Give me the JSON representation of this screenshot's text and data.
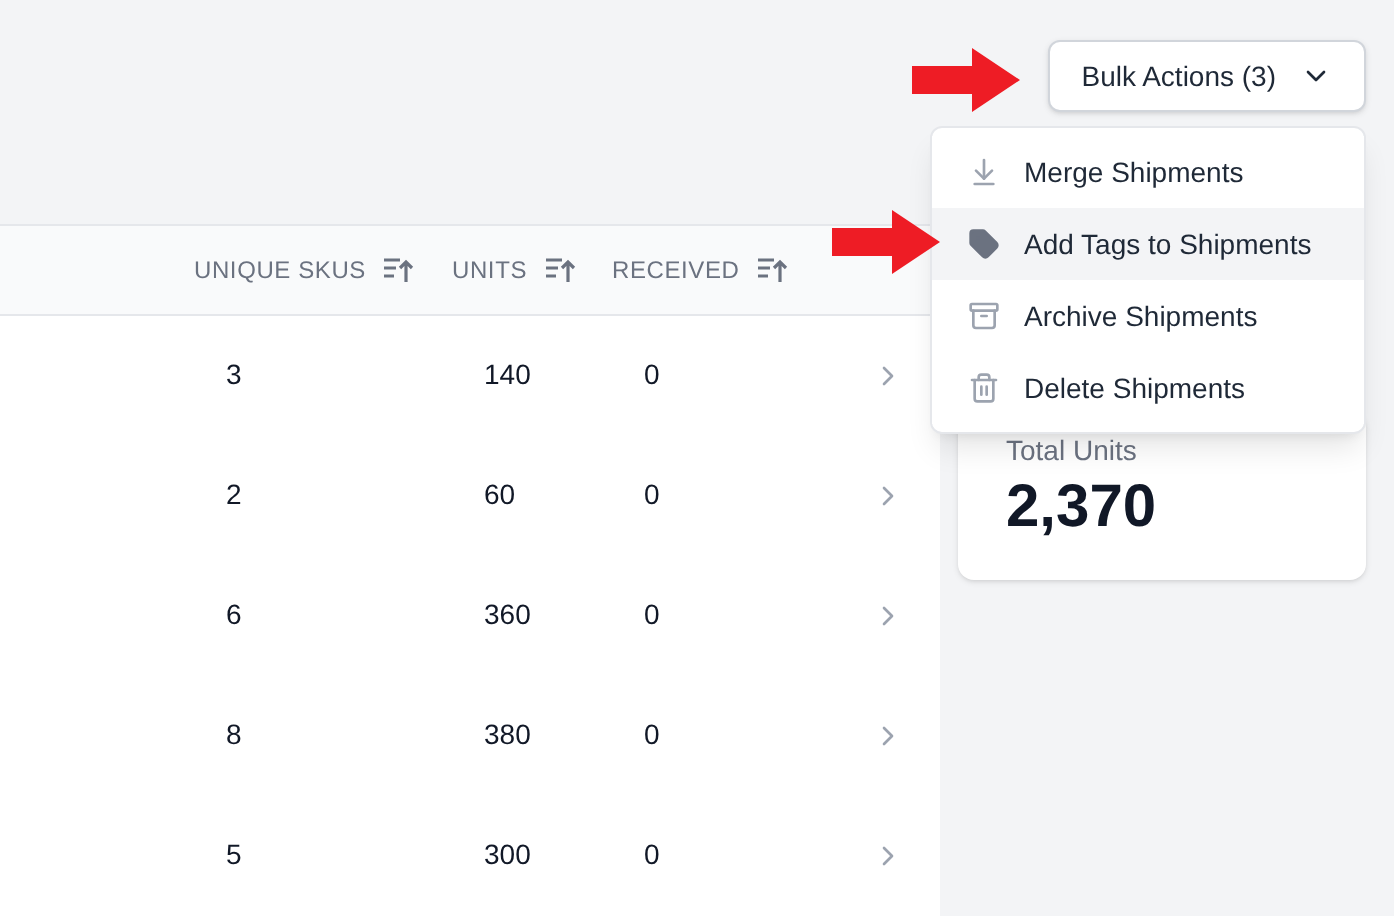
{
  "table": {
    "columns": [
      {
        "label": "UNIQUE SKUS"
      },
      {
        "label": "UNITS"
      },
      {
        "label": "RECEIVED"
      }
    ],
    "rows": [
      {
        "cells": [
          "3",
          "140",
          "0"
        ]
      },
      {
        "cells": [
          "2",
          "60",
          "0"
        ]
      },
      {
        "cells": [
          "6",
          "360",
          "0"
        ]
      },
      {
        "cells": [
          "8",
          "380",
          "0"
        ]
      },
      {
        "cells": [
          "5",
          "300",
          "0"
        ]
      }
    ]
  },
  "bulk_actions": {
    "label": "Bulk Actions (3)",
    "expanded": true,
    "menu": [
      {
        "label": "Merge Shipments",
        "kind": "merge",
        "selected": false
      },
      {
        "label": "Add Tags to Shipments",
        "kind": "tag",
        "selected": true
      },
      {
        "label": "Archive Shipments",
        "kind": "archive",
        "selected": false
      },
      {
        "label": "Delete Shipments",
        "kind": "delete",
        "selected": false
      }
    ]
  },
  "stat_card": {
    "label": "Total Units",
    "value": "2,370"
  }
}
